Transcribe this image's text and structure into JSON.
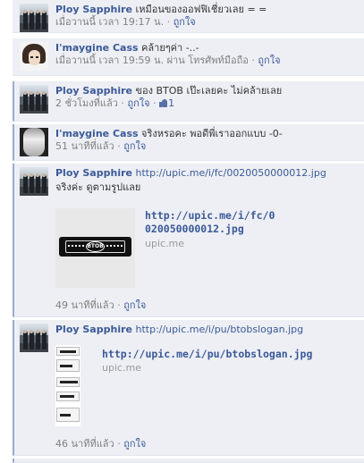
{
  "comments": [
    {
      "author": "Ploy Sapphire",
      "text": "เหมือนของออฟฟิเชี่ยวเลย = =",
      "time": "เมื่อวานนี้ เวลา 19:17 น.",
      "sep": " · ",
      "like": "ถูกใจ"
    },
    {
      "author": "I'maygine Cass",
      "text": "คล้ายๆค่า -..-",
      "time": "เมื่อวานนี้ เวลา 19:59 น. ผ่าน โทรศัพท์มือถือ",
      "sep": " · ",
      "like": "ถูกใจ"
    },
    {
      "author": "Ploy Sapphire",
      "text": "ของ BTOB เป๊ะเลยคะ ไม่คล้ายเลย",
      "time": "2 ชั่วโมงที่แล้ว",
      "sep": " · ",
      "like": "ถูกใจ",
      "sep2": " · ",
      "like_count": "1"
    },
    {
      "author": "I'maygine Cass",
      "text": "จริงหรอคะ พอดีพี่เราออกแบบ -0-",
      "time": "51 นาทีที่แล้ว",
      "sep": " · ",
      "like": "ถูกใจ"
    },
    {
      "author": "Ploy Sapphire",
      "text_link": "http://upic.me/i/fc/0020050000012.jpg",
      "text2": "จริงค่ะ ดูตามรูปแลย",
      "attachment": {
        "title": "http://upic.me/i/fc/0020050000012.jpg",
        "domain": "upic.me",
        "thumb_logo": "BTOB"
      },
      "time": "49 นาทีที่แล้ว",
      "sep": " · ",
      "like": "ถูกใจ"
    },
    {
      "author": "Ploy Sapphire",
      "text_link": "http://upic.me/i/pu/btobslogan.jpg",
      "attachment": {
        "title": "http://upic.me/i/pu/btobslogan.jpg",
        "domain": "upic.me"
      },
      "time": "46 นาทีที่แล้ว",
      "sep": " · ",
      "like": "ถูกใจ"
    }
  ],
  "colors": {
    "link": "#3b5998",
    "comment_bg": "#edeff4",
    "meta": "#808080"
  }
}
